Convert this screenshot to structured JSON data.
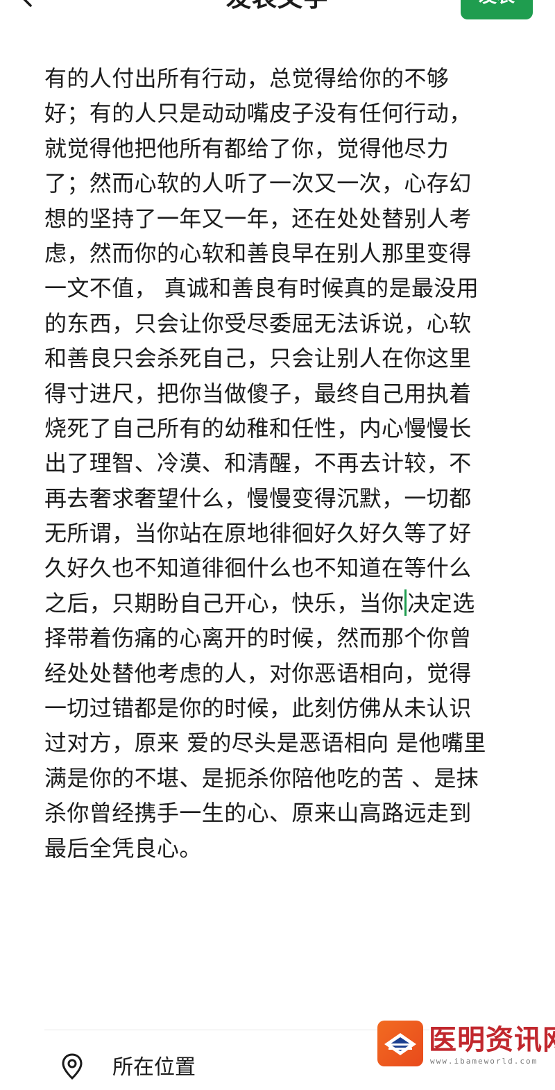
{
  "header": {
    "title": "发表文字",
    "publish_label": "发表",
    "back_icon": "chevron-left-icon",
    "accent_color": "#1f9d4f"
  },
  "editor": {
    "lines": [
      "有的人付出所有行动，总觉得给你的不够",
      "好；有的人只是动动嘴皮子没有任何行动，",
      "就觉得他把他所有都给了你，觉得他尽力",
      "了；然而心软的人听了一次又一次，心存幻",
      "想的坚持了一年又一年，还在处处替别人考",
      "虑，然而你的心软和善良早在别人那里变得",
      "一文不值， 真诚和善良有时候真的是最没用",
      "的东西，只会让你受尽委屈无法诉说，心软",
      "和善良只会杀死自己，只会让别人在你这里",
      "得寸进尺，把你当做傻子，最终自己用执着",
      "烧死了自己所有的幼稚和任性，内心慢慢长",
      "出了理智、冷漠、和清醒，不再去计较，不",
      "再去奢求奢望什么，慢慢变得沉默，一切都",
      "无所谓，当你站在原地徘徊好久好久等了好",
      "久好久也不知道徘徊什么也不知道在等什么",
      "之后，只期盼自己开心，快乐，当你",
      "择带着伤痛的心离开的时候，然而那个你曾",
      "经处处替他考虑的人，对你恶语相向，觉得",
      "一切过错都是你的时候，此刻仿佛从未认识",
      "过对方，原来 爱的尽头是恶语相向 是他嘴里",
      "满是你的不堪、是扼杀你陪他吃的苦 、是抹",
      "杀你曾经携手一生的心、原来山高路远走到",
      "最后全凭良心。"
    ],
    "caret_line_tail": "决定选"
  },
  "footer": {
    "location_label": "所在位置",
    "location_icon": "location-pin-icon"
  },
  "watermark": {
    "brand": "医明资讯网",
    "url": "www.ibameworld.com"
  }
}
